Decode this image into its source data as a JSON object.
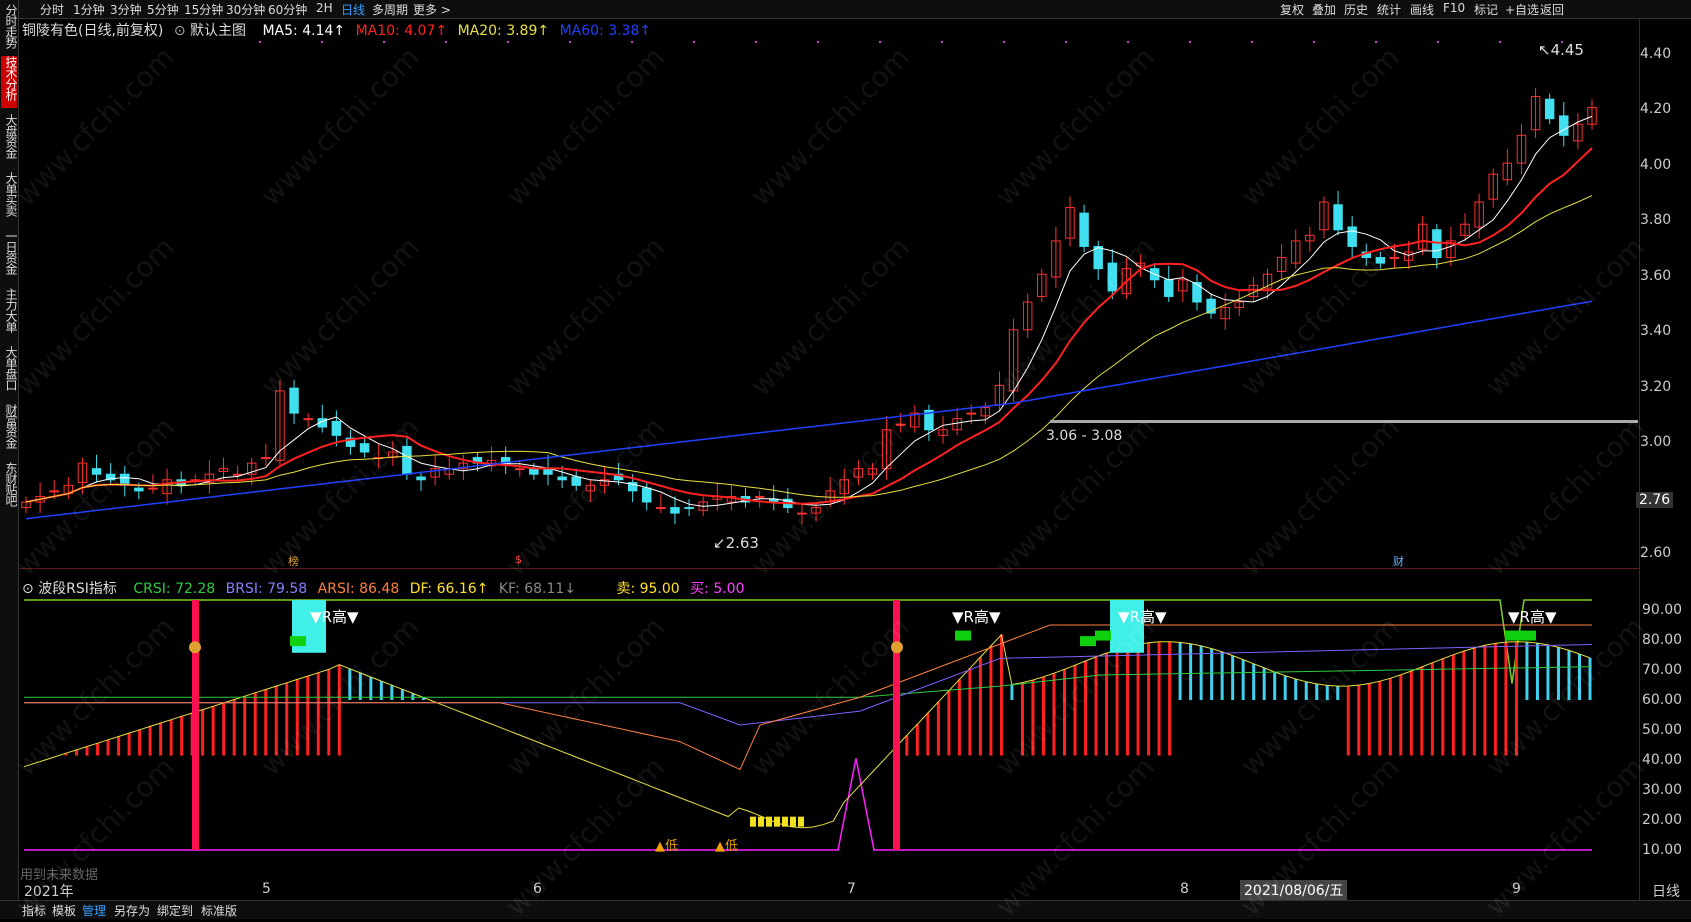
{
  "topbar": {
    "timeframes": [
      "分时",
      "1分钟",
      "3分钟",
      "5分钟",
      "15分钟",
      "30分钟",
      "60分钟",
      "2H",
      "日线",
      "多周期",
      "更多 >"
    ],
    "active": "日线",
    "right_buttons": [
      "复权",
      "叠加",
      "历史",
      "统计",
      "画线",
      "F10",
      "标记",
      "+自选",
      "返回"
    ]
  },
  "left_tabs": [
    "分时走势",
    "技术分析",
    "大盘资金",
    "大单买卖",
    "一日资金",
    "主力大单",
    "大单盘口",
    "财富资金",
    "东财贴吧"
  ],
  "left_active": "技术分析",
  "main_info": {
    "stock": "铜陵有色(日线,前复权)",
    "template": "默认主图",
    "ma5": "MA5: 4.14↑",
    "ma10": "MA10: 4.07↑",
    "ma20": "MA20: 3.89↑",
    "ma60": "MA60: 3.38↑"
  },
  "sub_info": {
    "name": "波段RSI指标",
    "crsi": "CRSI: 72.28",
    "brsi": "BRSI: 79.58",
    "arsi": "ARSI: 86.48",
    "df": "DF: 66.16↑",
    "kf": "KF: 68.11↓",
    "sell": "卖: 95.00",
    "buy": "买: 5.00"
  },
  "price_axis": [
    "4.40",
    "4.20",
    "4.00",
    "3.80",
    "3.60",
    "3.40",
    "3.20",
    "3.00",
    "2.60"
  ],
  "current_price": "2.76",
  "ind_axis": [
    "90.00",
    "80.00",
    "70.00",
    "60.00",
    "50.00",
    "40.00",
    "30.00",
    "20.00",
    "10.00"
  ],
  "annotations": {
    "high": "4.45",
    "low": "2.63",
    "range": "3.06 - 3.08",
    "r_high": "▼R高▼",
    "future_data": "用到未来数据",
    "event_bang": "榜",
    "event_cai": "财",
    "event_s": "$",
    "buy_mark": "▲低",
    "buy_mark2": "▲低"
  },
  "x_axis": {
    "year": "2021年",
    "months": [
      "5",
      "6",
      "7",
      "8",
      "9"
    ],
    "cursor_date": "2021/08/06/五",
    "period": "日线"
  },
  "bottom_bar": [
    "指标",
    "模板",
    "管理",
    "另存为",
    "绑定到",
    "标准版"
  ],
  "bottom_active": "管理",
  "colors": {
    "up": "#ff3030",
    "down": "#40e0f0",
    "ma5": "#ffffff",
    "ma10": "#ff2020",
    "ma20": "#e8e040",
    "ma60": "#2040ff",
    "signal": "#ff1050",
    "buyline": "#ff20ff"
  },
  "watermark": "www.cfchi.com"
}
